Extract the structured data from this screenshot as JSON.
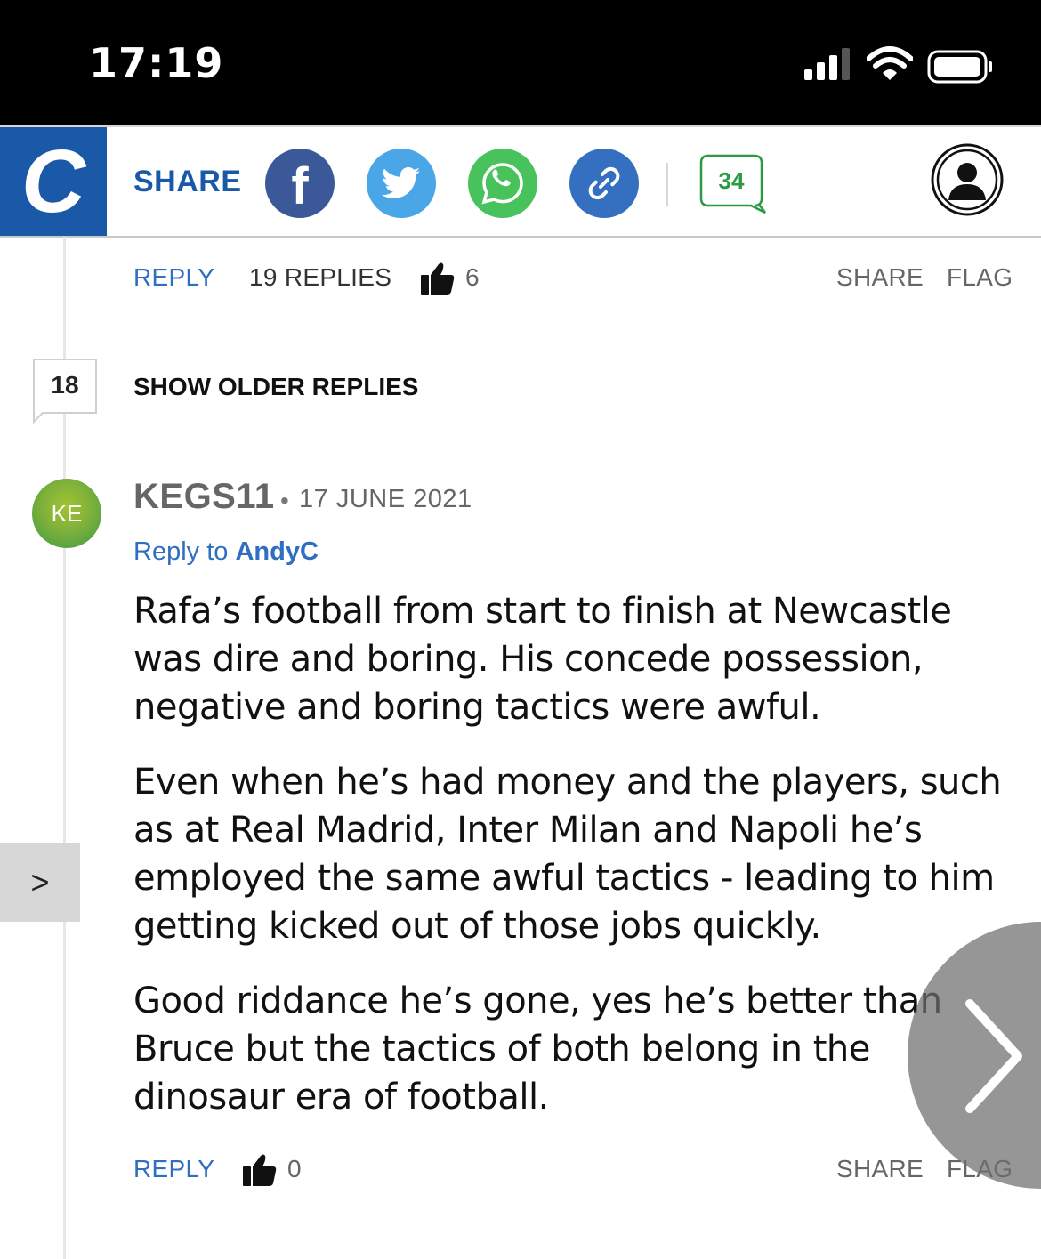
{
  "status_bar": {
    "time": "17:19"
  },
  "header": {
    "logo_letter": "C",
    "share_label": "SHARE",
    "social": [
      {
        "name": "facebook",
        "icon": "facebook-icon",
        "glyph": "f",
        "color": "#3b5998"
      },
      {
        "name": "twitter",
        "icon": "twitter-icon",
        "color": "#4aa6e6"
      },
      {
        "name": "whatsapp",
        "icon": "whatsapp-icon",
        "color": "#48c25a"
      },
      {
        "name": "copy-link",
        "icon": "link-icon",
        "color": "#3570c0"
      }
    ],
    "comment_count": "34",
    "account_icon": "user-icon"
  },
  "parent_actions": {
    "reply": "REPLY",
    "replies": "19 REPLIES",
    "likes": "6",
    "share": "SHARE",
    "flag": "FLAG"
  },
  "older_replies": {
    "count": "18",
    "label": "SHOW OLDER REPLIES"
  },
  "comment": {
    "avatar_initials": "KE",
    "username": "KEGS11",
    "separator": "•",
    "date": "17 JUNE 2021",
    "reply_to_prefix": "Reply to ",
    "reply_to_user": "AndyC",
    "paragraphs": [
      "Rafa’s football from start to finish at Newcastle was dire and boring. His concede possession, negative and boring tactics were awful.",
      "Even when he’s had money and the players, such as at Real Madrid, Inter Milan and Napoli he’s employed the same awful tactics - leading to him getting kicked out of those jobs quickly.",
      "Good riddance he’s gone, yes he’s better than Bruce but the tactics of both belong in the dinosaur era of football."
    ],
    "actions": {
      "reply": "REPLY",
      "likes": "0",
      "share": "SHARE",
      "flag": "FLAG"
    }
  },
  "side_tab": {
    "label": ">"
  },
  "colors": {
    "brand_blue": "#1a58a8",
    "link_blue": "#2f6ec0",
    "whatsapp_green": "#48c25a"
  }
}
